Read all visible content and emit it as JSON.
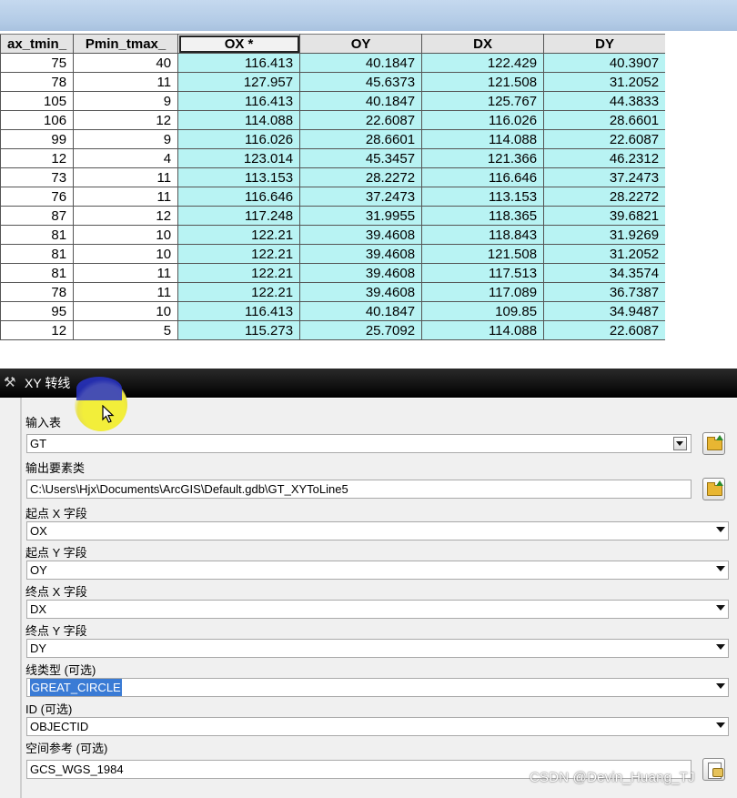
{
  "table": {
    "columns": [
      "ax_tmin_",
      "Pmin_tmax_",
      "OX *",
      "OY",
      "DX",
      "DY"
    ],
    "rows": [
      [
        "75",
        "40",
        "116.413",
        "40.1847",
        "122.429",
        "40.3907"
      ],
      [
        "78",
        "11",
        "127.957",
        "45.6373",
        "121.508",
        "31.2052"
      ],
      [
        "105",
        "9",
        "116.413",
        "40.1847",
        "125.767",
        "44.3833"
      ],
      [
        "106",
        "12",
        "114.088",
        "22.6087",
        "116.026",
        "28.6601"
      ],
      [
        "99",
        "9",
        "116.026",
        "28.6601",
        "114.088",
        "22.6087"
      ],
      [
        "12",
        "4",
        "123.014",
        "45.3457",
        "121.366",
        "46.2312"
      ],
      [
        "73",
        "11",
        "113.153",
        "28.2272",
        "116.646",
        "37.2473"
      ],
      [
        "76",
        "11",
        "116.646",
        "37.2473",
        "113.153",
        "28.2272"
      ],
      [
        "87",
        "12",
        "117.248",
        "31.9955",
        "118.365",
        "39.6821"
      ],
      [
        "81",
        "10",
        "122.21",
        "39.4608",
        "118.843",
        "31.9269"
      ],
      [
        "81",
        "10",
        "122.21",
        "39.4608",
        "121.508",
        "31.2052"
      ],
      [
        "81",
        "11",
        "122.21",
        "39.4608",
        "117.513",
        "34.3574"
      ],
      [
        "78",
        "11",
        "122.21",
        "39.4608",
        "117.089",
        "36.7387"
      ],
      [
        "95",
        "10",
        "116.413",
        "40.1847",
        "109.85",
        "34.9487"
      ],
      [
        "12",
        "5",
        "115.273",
        "25.7092",
        "114.088",
        "22.6087"
      ]
    ],
    "selected_color": "#b8f3f3"
  },
  "dialog": {
    "title": "XY 转线",
    "title_icon": "hammer-icon",
    "fields": {
      "input_table": {
        "label": "输入表",
        "value": "GT"
      },
      "output_class": {
        "label": "输出要素类",
        "value": "C:\\Users\\Hjx\\Documents\\ArcGIS\\Default.gdb\\GT_XYToLine5"
      },
      "start_x": {
        "label": "起点 X 字段",
        "value": "OX"
      },
      "start_y": {
        "label": "起点 Y 字段",
        "value": "OY"
      },
      "end_x": {
        "label": "终点 X 字段",
        "value": "DX"
      },
      "end_y": {
        "label": "终点 Y 字段",
        "value": "DY"
      },
      "line_type": {
        "label": "线类型 (可选)",
        "value": "GREAT_CIRCLE"
      },
      "id": {
        "label": "ID (可选)",
        "value": "OBJECTID"
      },
      "spatial_ref": {
        "label": "空间参考 (可选)",
        "value": "GCS_WGS_1984"
      }
    }
  },
  "watermark": "CSDN @Devin_Huang_TJ"
}
